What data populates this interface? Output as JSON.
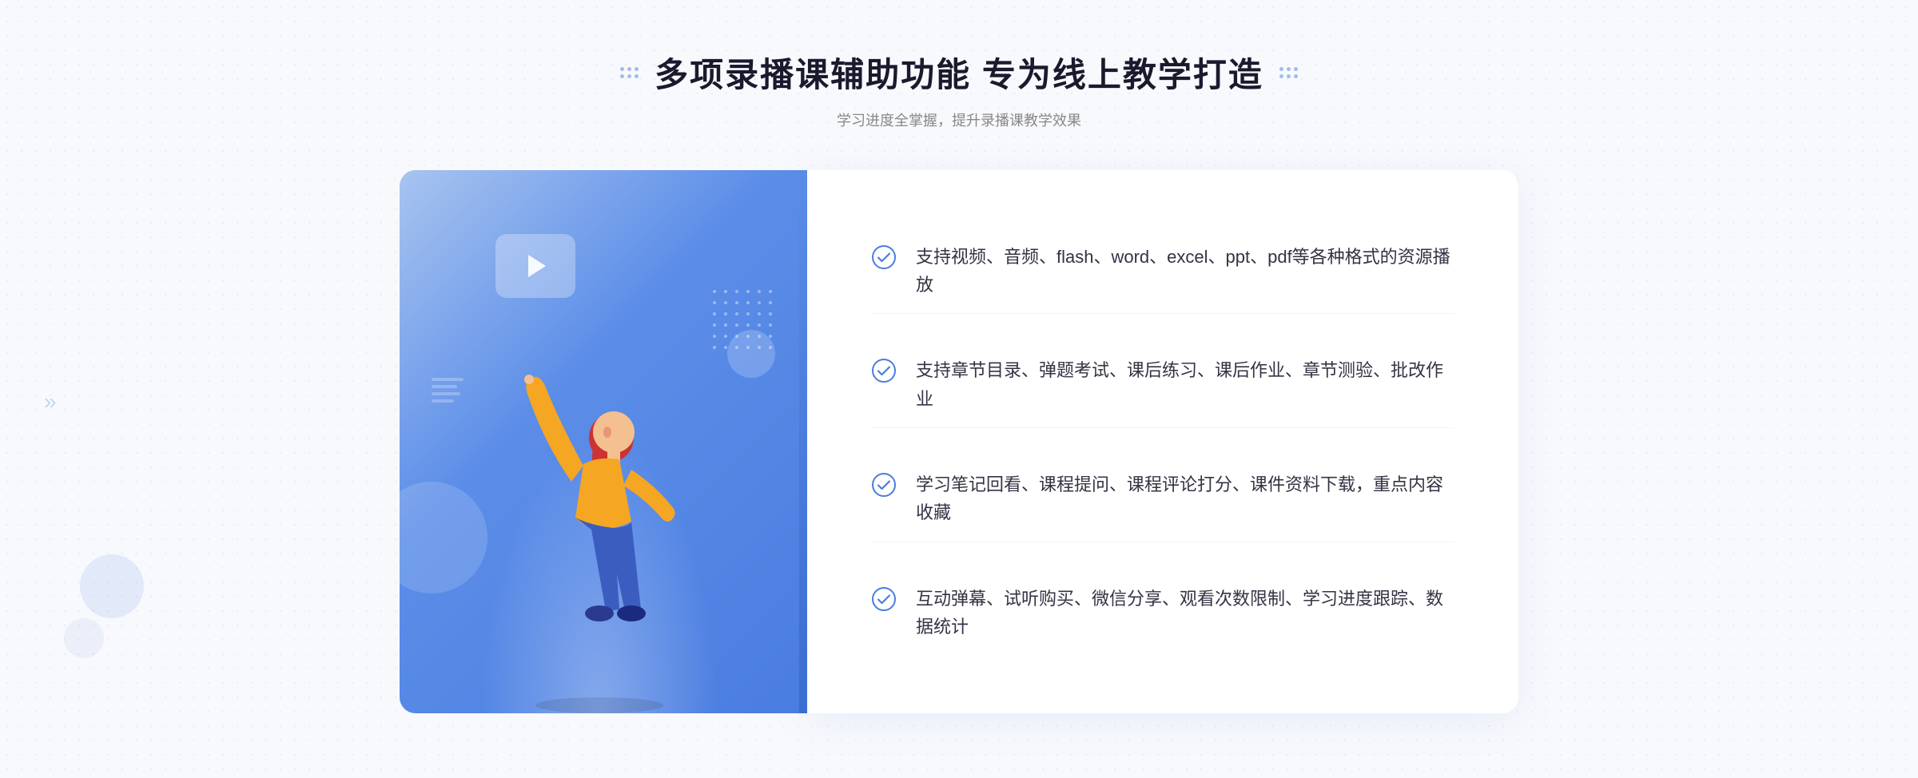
{
  "header": {
    "title": "多项录播课辅助功能 专为线上教学打造",
    "subtitle": "学习进度全掌握，提升录播课教学效果"
  },
  "features": [
    {
      "id": 1,
      "text": "支持视频、音频、flash、word、excel、ppt、pdf等各种格式的资源播放"
    },
    {
      "id": 2,
      "text": "支持章节目录、弹题考试、课后练习、课后作业、章节测验、批改作业"
    },
    {
      "id": 3,
      "text": "学习笔记回看、课程提问、课程评论打分、课件资料下载，重点内容收藏"
    },
    {
      "id": 4,
      "text": "互动弹幕、试听购买、微信分享、观看次数限制、学习进度跟踪、数据统计"
    }
  ],
  "colors": {
    "primary": "#4a7de0",
    "title": "#1a1a2e",
    "subtitle": "#888888",
    "feature_text": "#333344",
    "check_color": "#4a7de0"
  }
}
